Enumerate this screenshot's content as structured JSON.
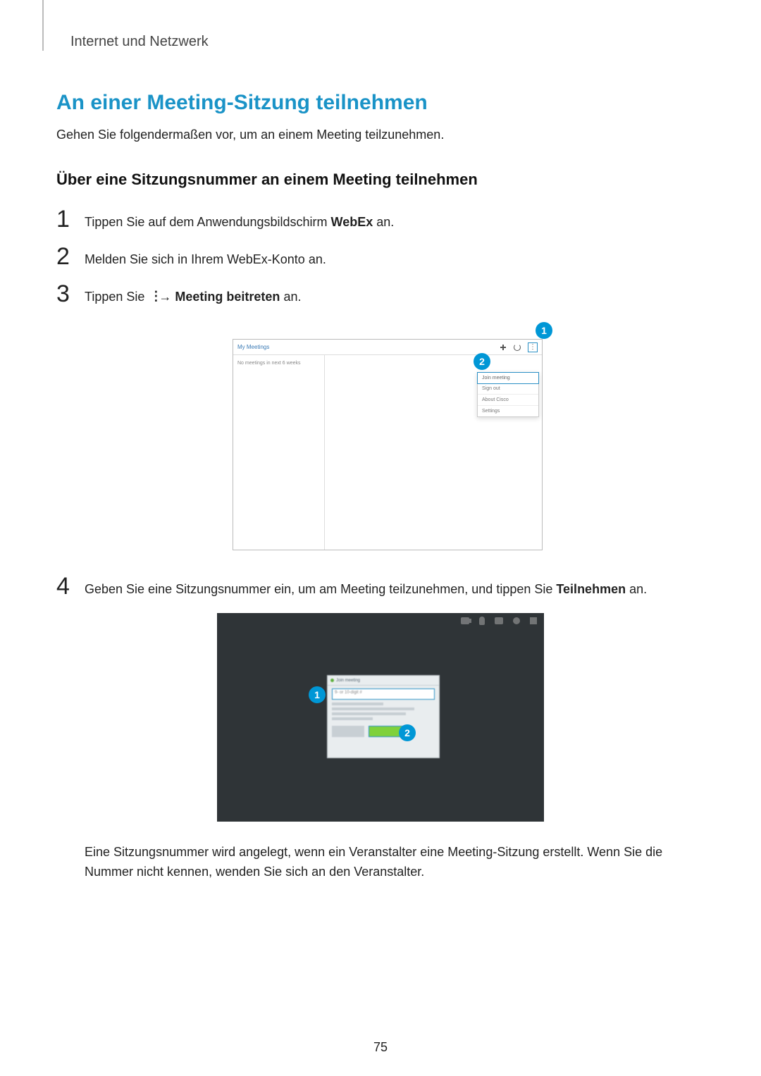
{
  "header": {
    "chapter": "Internet und Netzwerk"
  },
  "section": {
    "title": "An einer Meeting-Sitzung teilnehmen",
    "intro": "Gehen Sie folgendermaßen vor, um an einem Meeting teilzunehmen."
  },
  "subsection": {
    "heading": "Über eine Sitzungsnummer an einem Meeting teilnehmen"
  },
  "steps": {
    "s1": {
      "num": "1",
      "pre": "Tippen Sie auf dem Anwendungsbildschirm ",
      "bold": "WebEx",
      "post": " an."
    },
    "s2": {
      "num": "2",
      "text": "Melden Sie sich in Ihrem WebEx-Konto an."
    },
    "s3": {
      "num": "3",
      "pre": "Tippen Sie ",
      "arrow": " → ",
      "bold": "Meeting beitreten",
      "post": " an."
    },
    "s4": {
      "num": "4",
      "pre": "Geben Sie eine Sitzungsnummer ein, um am Meeting teilzunehmen, und tippen Sie ",
      "bold": "Teilnehmen",
      "post": " an."
    }
  },
  "fig1": {
    "title": "My Meetings",
    "side_text": "No meetings in next 6 weeks",
    "menu": [
      "Join meeting",
      "Sign out",
      "About Cisco",
      "Settings"
    ],
    "callouts": {
      "c1": "1",
      "c2": "2"
    }
  },
  "fig2": {
    "dialog_title": "Join meeting",
    "field_placeholder": "9- or 10-digit #",
    "callouts": {
      "c1": "1",
      "c2": "2"
    }
  },
  "note": "Eine Sitzungsnummer wird angelegt, wenn ein Veranstalter eine Meeting-Sitzung erstellt. Wenn Sie die Nummer nicht kennen, wenden Sie sich an den Veranstalter.",
  "page_number": "75"
}
